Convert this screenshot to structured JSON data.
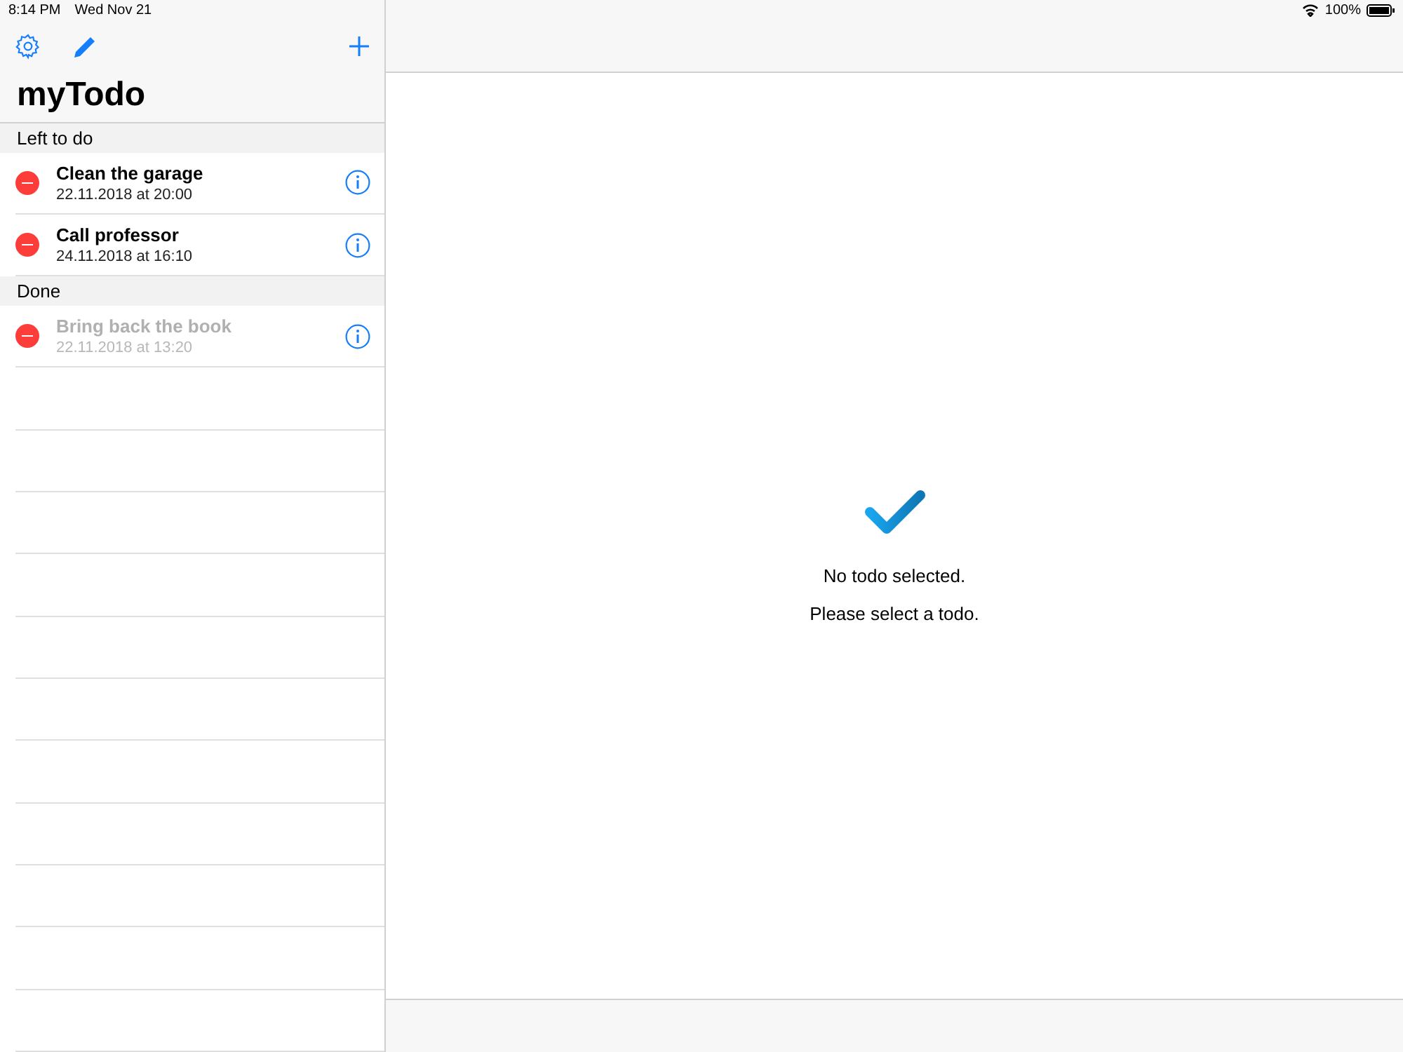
{
  "status_bar": {
    "time": "8:14 PM",
    "date": "Wed Nov 21",
    "battery": "100%"
  },
  "title": "myTodo",
  "sections": [
    {
      "header": "Left to do",
      "items": [
        {
          "title": "Clean the garage",
          "date": "22.11.2018 at 20:00",
          "done": false
        },
        {
          "title": "Call professor",
          "date": "24.11.2018 at 16:10",
          "done": false
        }
      ]
    },
    {
      "header": "Done",
      "items": [
        {
          "title": "Bring back the book",
          "date": "22.11.2018 at 13:20",
          "done": true
        }
      ]
    }
  ],
  "detail": {
    "message": "No todo selected.",
    "hint": "Please select a todo."
  }
}
